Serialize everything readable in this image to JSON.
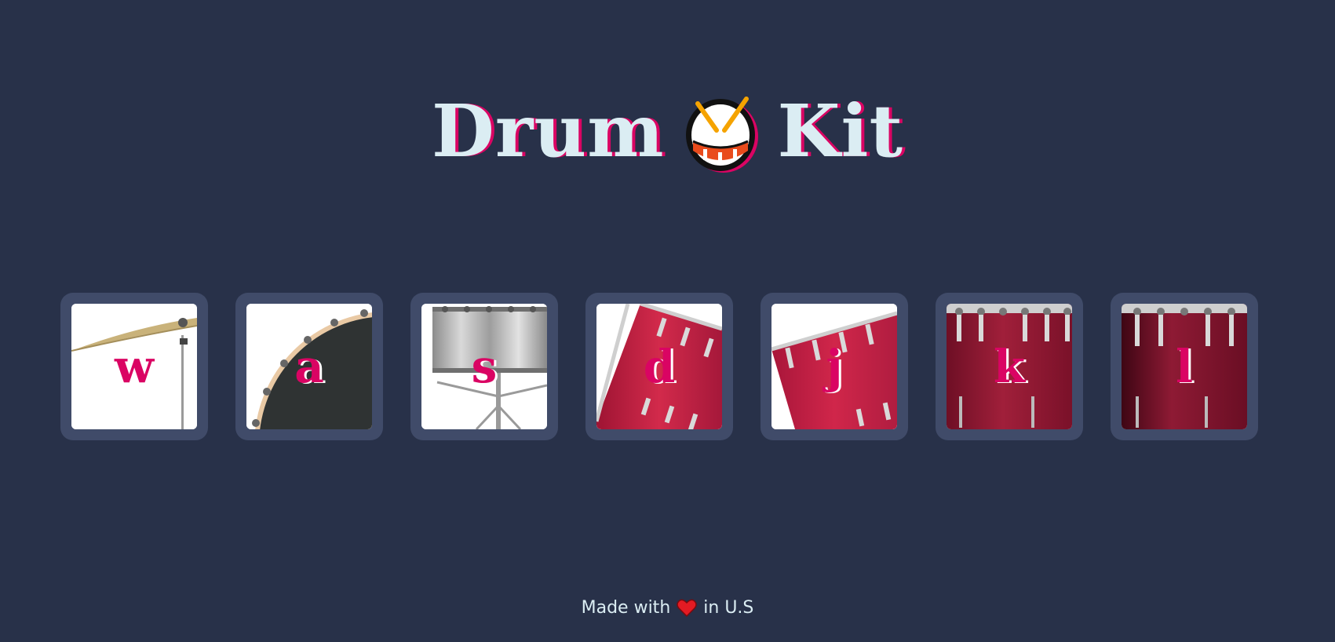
{
  "header": {
    "title_left": "Drum",
    "title_icon": "drum-emoji",
    "title_right": "Kit",
    "colors": {
      "text": "#dbedf3",
      "shadow": "#da0463",
      "background": "#283149"
    }
  },
  "keys": [
    {
      "letter": "w",
      "sound": "crash",
      "icon": "crash-cymbal"
    },
    {
      "letter": "a",
      "sound": "kick-bass",
      "icon": "kick-drum"
    },
    {
      "letter": "s",
      "sound": "snare",
      "icon": "snare-drum"
    },
    {
      "letter": "d",
      "sound": "tom-1",
      "icon": "tom-drum"
    },
    {
      "letter": "j",
      "sound": "tom-2",
      "icon": "tom-drum"
    },
    {
      "letter": "k",
      "sound": "tom-3",
      "icon": "floor-tom"
    },
    {
      "letter": "l",
      "sound": "tom-4",
      "icon": "floor-tom"
    }
  ],
  "key_colors": {
    "tile": "#404b69",
    "letter": "#da0463"
  },
  "footer": {
    "made_with": "Made with",
    "icon": "heart-icon",
    "location": "in U.S"
  }
}
